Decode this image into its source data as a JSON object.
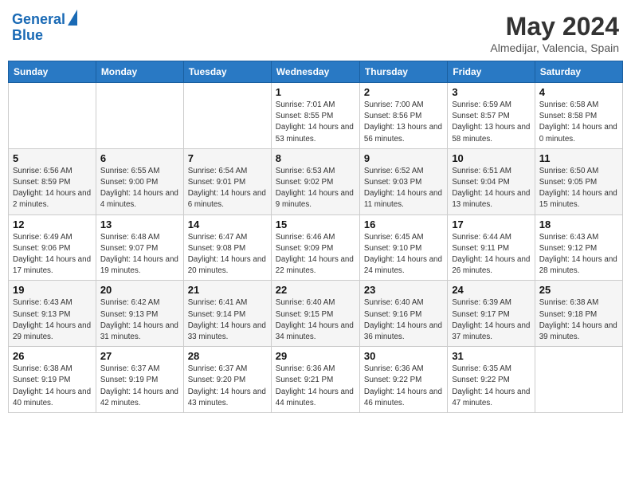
{
  "header": {
    "logo_line1": "General",
    "logo_line2": "Blue",
    "month": "May 2024",
    "location": "Almedijar, Valencia, Spain"
  },
  "days_of_week": [
    "Sunday",
    "Monday",
    "Tuesday",
    "Wednesday",
    "Thursday",
    "Friday",
    "Saturday"
  ],
  "weeks": [
    [
      {
        "day": "",
        "sunrise": "",
        "sunset": "",
        "daylight": ""
      },
      {
        "day": "",
        "sunrise": "",
        "sunset": "",
        "daylight": ""
      },
      {
        "day": "",
        "sunrise": "",
        "sunset": "",
        "daylight": ""
      },
      {
        "day": "1",
        "sunrise": "Sunrise: 7:01 AM",
        "sunset": "Sunset: 8:55 PM",
        "daylight": "Daylight: 14 hours and 53 minutes."
      },
      {
        "day": "2",
        "sunrise": "Sunrise: 7:00 AM",
        "sunset": "Sunset: 8:56 PM",
        "daylight": "Daylight: 13 hours and 56 minutes."
      },
      {
        "day": "3",
        "sunrise": "Sunrise: 6:59 AM",
        "sunset": "Sunset: 8:57 PM",
        "daylight": "Daylight: 13 hours and 58 minutes."
      },
      {
        "day": "4",
        "sunrise": "Sunrise: 6:58 AM",
        "sunset": "Sunset: 8:58 PM",
        "daylight": "Daylight: 14 hours and 0 minutes."
      }
    ],
    [
      {
        "day": "5",
        "sunrise": "Sunrise: 6:56 AM",
        "sunset": "Sunset: 8:59 PM",
        "daylight": "Daylight: 14 hours and 2 minutes."
      },
      {
        "day": "6",
        "sunrise": "Sunrise: 6:55 AM",
        "sunset": "Sunset: 9:00 PM",
        "daylight": "Daylight: 14 hours and 4 minutes."
      },
      {
        "day": "7",
        "sunrise": "Sunrise: 6:54 AM",
        "sunset": "Sunset: 9:01 PM",
        "daylight": "Daylight: 14 hours and 6 minutes."
      },
      {
        "day": "8",
        "sunrise": "Sunrise: 6:53 AM",
        "sunset": "Sunset: 9:02 PM",
        "daylight": "Daylight: 14 hours and 9 minutes."
      },
      {
        "day": "9",
        "sunrise": "Sunrise: 6:52 AM",
        "sunset": "Sunset: 9:03 PM",
        "daylight": "Daylight: 14 hours and 11 minutes."
      },
      {
        "day": "10",
        "sunrise": "Sunrise: 6:51 AM",
        "sunset": "Sunset: 9:04 PM",
        "daylight": "Daylight: 14 hours and 13 minutes."
      },
      {
        "day": "11",
        "sunrise": "Sunrise: 6:50 AM",
        "sunset": "Sunset: 9:05 PM",
        "daylight": "Daylight: 14 hours and 15 minutes."
      }
    ],
    [
      {
        "day": "12",
        "sunrise": "Sunrise: 6:49 AM",
        "sunset": "Sunset: 9:06 PM",
        "daylight": "Daylight: 14 hours and 17 minutes."
      },
      {
        "day": "13",
        "sunrise": "Sunrise: 6:48 AM",
        "sunset": "Sunset: 9:07 PM",
        "daylight": "Daylight: 14 hours and 19 minutes."
      },
      {
        "day": "14",
        "sunrise": "Sunrise: 6:47 AM",
        "sunset": "Sunset: 9:08 PM",
        "daylight": "Daylight: 14 hours and 20 minutes."
      },
      {
        "day": "15",
        "sunrise": "Sunrise: 6:46 AM",
        "sunset": "Sunset: 9:09 PM",
        "daylight": "Daylight: 14 hours and 22 minutes."
      },
      {
        "day": "16",
        "sunrise": "Sunrise: 6:45 AM",
        "sunset": "Sunset: 9:10 PM",
        "daylight": "Daylight: 14 hours and 24 minutes."
      },
      {
        "day": "17",
        "sunrise": "Sunrise: 6:44 AM",
        "sunset": "Sunset: 9:11 PM",
        "daylight": "Daylight: 14 hours and 26 minutes."
      },
      {
        "day": "18",
        "sunrise": "Sunrise: 6:43 AM",
        "sunset": "Sunset: 9:12 PM",
        "daylight": "Daylight: 14 hours and 28 minutes."
      }
    ],
    [
      {
        "day": "19",
        "sunrise": "Sunrise: 6:43 AM",
        "sunset": "Sunset: 9:13 PM",
        "daylight": "Daylight: 14 hours and 29 minutes."
      },
      {
        "day": "20",
        "sunrise": "Sunrise: 6:42 AM",
        "sunset": "Sunset: 9:13 PM",
        "daylight": "Daylight: 14 hours and 31 minutes."
      },
      {
        "day": "21",
        "sunrise": "Sunrise: 6:41 AM",
        "sunset": "Sunset: 9:14 PM",
        "daylight": "Daylight: 14 hours and 33 minutes."
      },
      {
        "day": "22",
        "sunrise": "Sunrise: 6:40 AM",
        "sunset": "Sunset: 9:15 PM",
        "daylight": "Daylight: 14 hours and 34 minutes."
      },
      {
        "day": "23",
        "sunrise": "Sunrise: 6:40 AM",
        "sunset": "Sunset: 9:16 PM",
        "daylight": "Daylight: 14 hours and 36 minutes."
      },
      {
        "day": "24",
        "sunrise": "Sunrise: 6:39 AM",
        "sunset": "Sunset: 9:17 PM",
        "daylight": "Daylight: 14 hours and 37 minutes."
      },
      {
        "day": "25",
        "sunrise": "Sunrise: 6:38 AM",
        "sunset": "Sunset: 9:18 PM",
        "daylight": "Daylight: 14 hours and 39 minutes."
      }
    ],
    [
      {
        "day": "26",
        "sunrise": "Sunrise: 6:38 AM",
        "sunset": "Sunset: 9:19 PM",
        "daylight": "Daylight: 14 hours and 40 minutes."
      },
      {
        "day": "27",
        "sunrise": "Sunrise: 6:37 AM",
        "sunset": "Sunset: 9:19 PM",
        "daylight": "Daylight: 14 hours and 42 minutes."
      },
      {
        "day": "28",
        "sunrise": "Sunrise: 6:37 AM",
        "sunset": "Sunset: 9:20 PM",
        "daylight": "Daylight: 14 hours and 43 minutes."
      },
      {
        "day": "29",
        "sunrise": "Sunrise: 6:36 AM",
        "sunset": "Sunset: 9:21 PM",
        "daylight": "Daylight: 14 hours and 44 minutes."
      },
      {
        "day": "30",
        "sunrise": "Sunrise: 6:36 AM",
        "sunset": "Sunset: 9:22 PM",
        "daylight": "Daylight: 14 hours and 46 minutes."
      },
      {
        "day": "31",
        "sunrise": "Sunrise: 6:35 AM",
        "sunset": "Sunset: 9:22 PM",
        "daylight": "Daylight: 14 hours and 47 minutes."
      },
      {
        "day": "",
        "sunrise": "",
        "sunset": "",
        "daylight": ""
      }
    ]
  ]
}
